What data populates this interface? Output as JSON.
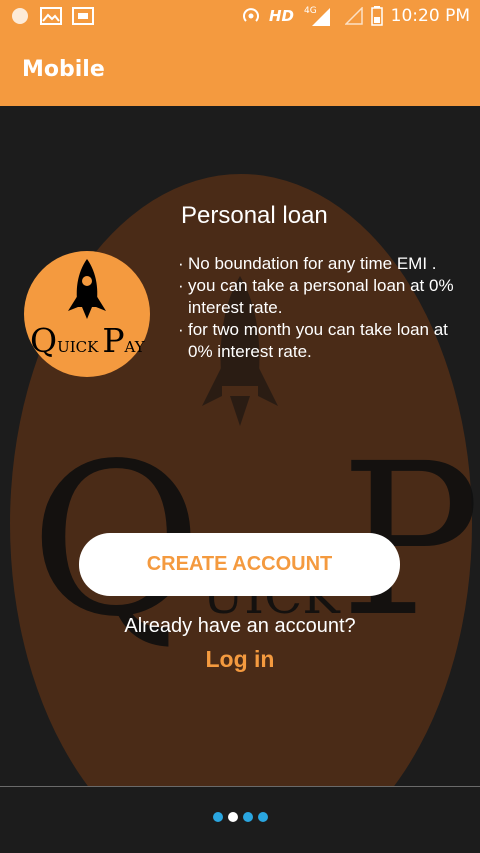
{
  "status_bar": {
    "network_label": "HD",
    "signal_label": "4G",
    "time": "10:20 PM",
    "icons": [
      "notification-icon",
      "photo-icon",
      "screenshot-icon",
      "hotspot-icon",
      "signal-icon",
      "battery-icon"
    ]
  },
  "app_bar": {
    "title": "Mobile"
  },
  "logo": {
    "big_q": "Q",
    "small_uick": "UICK",
    "big_p": "P",
    "small_ay": "AY"
  },
  "card": {
    "title": "Personal loan",
    "bullets": [
      "No boundation for any time EMI .",
      "you can take a personal loan at 0% interest rate.",
      "for two month you can take loan at 0% interest rate."
    ]
  },
  "actions": {
    "create_account": "CREATE ACCOUNT",
    "already_text": "Already have an account?",
    "login_link": "Log in"
  },
  "pager": {
    "count": 4,
    "active_index": 1
  },
  "colors": {
    "accent": "#f49a3f",
    "background": "#1c1c1c",
    "dot": "#2aa6e0"
  }
}
